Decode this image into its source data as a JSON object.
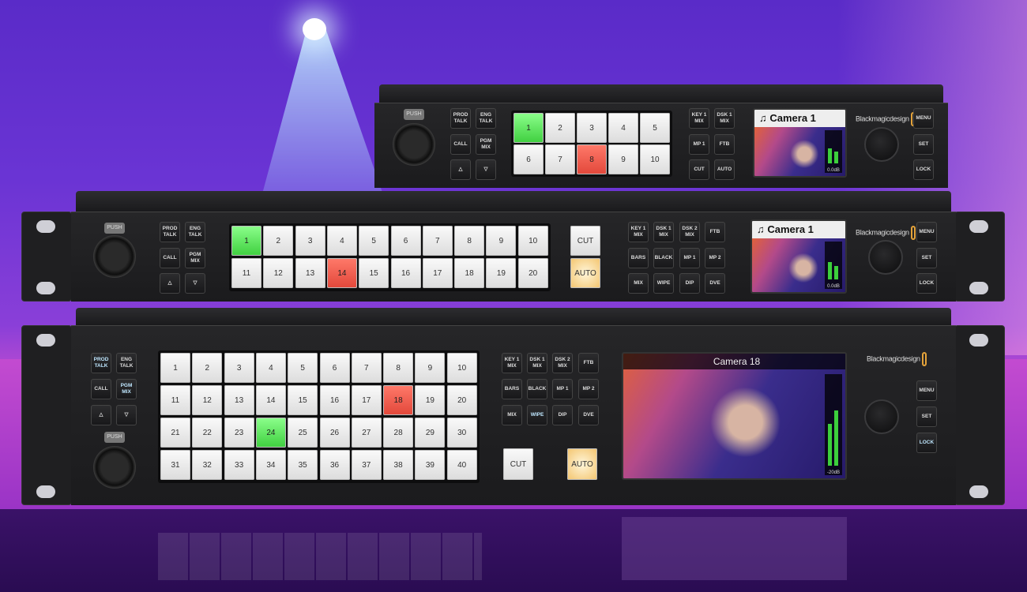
{
  "brand": "Blackmagicdesign",
  "xlr_label": "PUSH",
  "colors": {
    "program": "#e2473a",
    "preview": "#3fcf3f",
    "auto": "#f3c36b",
    "background": "#6a34d4"
  },
  "panels": [
    {
      "id": "small",
      "talk": [
        "PROD\nTALK",
        "ENG\nTALK",
        "CALL",
        "PGM\nMIX",
        "△",
        "▽"
      ],
      "talk_lit": [],
      "sources": [
        "1",
        "2",
        "3",
        "4",
        "5",
        "6",
        "7",
        "8",
        "9",
        "10"
      ],
      "preview": "1",
      "program": "8",
      "transition": [
        "KEY 1\nMIX",
        "DSK 1\nMIX",
        "MP 1",
        "FTB",
        "CUT",
        "AUTO"
      ],
      "transition_lit": [],
      "cut_label": "",
      "auto_label": "",
      "lcd": {
        "icon": "music-note-icon",
        "title": "♫ Camera 1",
        "level": "0.0dB",
        "audio_levels": [
          0.45,
          0.35
        ]
      },
      "menu": [
        "MENU",
        "SET",
        "LOCK"
      ],
      "menu_lit": []
    },
    {
      "id": "medium",
      "talk": [
        "PROD\nTALK",
        "ENG\nTALK",
        "CALL",
        "PGM\nMIX",
        "△",
        "▽"
      ],
      "talk_lit": [],
      "sources": [
        "1",
        "2",
        "3",
        "4",
        "5",
        "6",
        "7",
        "8",
        "9",
        "10",
        "11",
        "12",
        "13",
        "14",
        "15",
        "16",
        "17",
        "18",
        "19",
        "20"
      ],
      "preview": "1",
      "program": "14",
      "transition": [
        "KEY 1\nMIX",
        "DSK 1\nMIX",
        "DSK 2\nMIX",
        "FTB",
        "BARS",
        "BLACK",
        "MP 1",
        "MP 2",
        "MIX",
        "WIPE",
        "DIP",
        "DVE"
      ],
      "transition_lit": [],
      "cut_label": "CUT",
      "auto_label": "AUTO",
      "lcd": {
        "icon": "music-note-icon",
        "title": "♫ Camera 1",
        "level": "0.0dB",
        "audio_levels": [
          0.45,
          0.35
        ]
      },
      "menu": [
        "MENU",
        "SET",
        "LOCK"
      ],
      "menu_lit": []
    },
    {
      "id": "large",
      "talk": [
        "PROD\nTALK",
        "ENG\nTALK",
        "CALL",
        "PGM\nMIX",
        "△",
        "▽"
      ],
      "talk_lit": [
        "PROD\nTALK",
        "PGM\nMIX"
      ],
      "sources": [
        "1",
        "2",
        "3",
        "4",
        "5",
        "6",
        "7",
        "8",
        "9",
        "10",
        "11",
        "12",
        "13",
        "14",
        "15",
        "16",
        "17",
        "18",
        "19",
        "20",
        "21",
        "22",
        "23",
        "24",
        "25",
        "26",
        "27",
        "28",
        "29",
        "30",
        "31",
        "32",
        "33",
        "34",
        "35",
        "36",
        "37",
        "38",
        "39",
        "40"
      ],
      "preview": "24",
      "program": "18",
      "transition": [
        "KEY 1\nMIX",
        "DSK 1\nMIX",
        "DSK 2\nMIX",
        "FTB",
        "BARS",
        "BLACK",
        "MP 1",
        "MP 2",
        "MIX",
        "WIPE",
        "DIP",
        "DVE"
      ],
      "transition_lit": [
        "WIPE"
      ],
      "cut_label": "CUT",
      "auto_label": "AUTO",
      "lcd": {
        "icon": "music-note-icon",
        "title": "Camera 18",
        "level": "-20dB",
        "audio_levels": [
          0.45,
          0.6
        ]
      },
      "menu": [
        "MENU",
        "SET",
        "LOCK"
      ],
      "menu_lit": [
        "LOCK"
      ]
    }
  ]
}
